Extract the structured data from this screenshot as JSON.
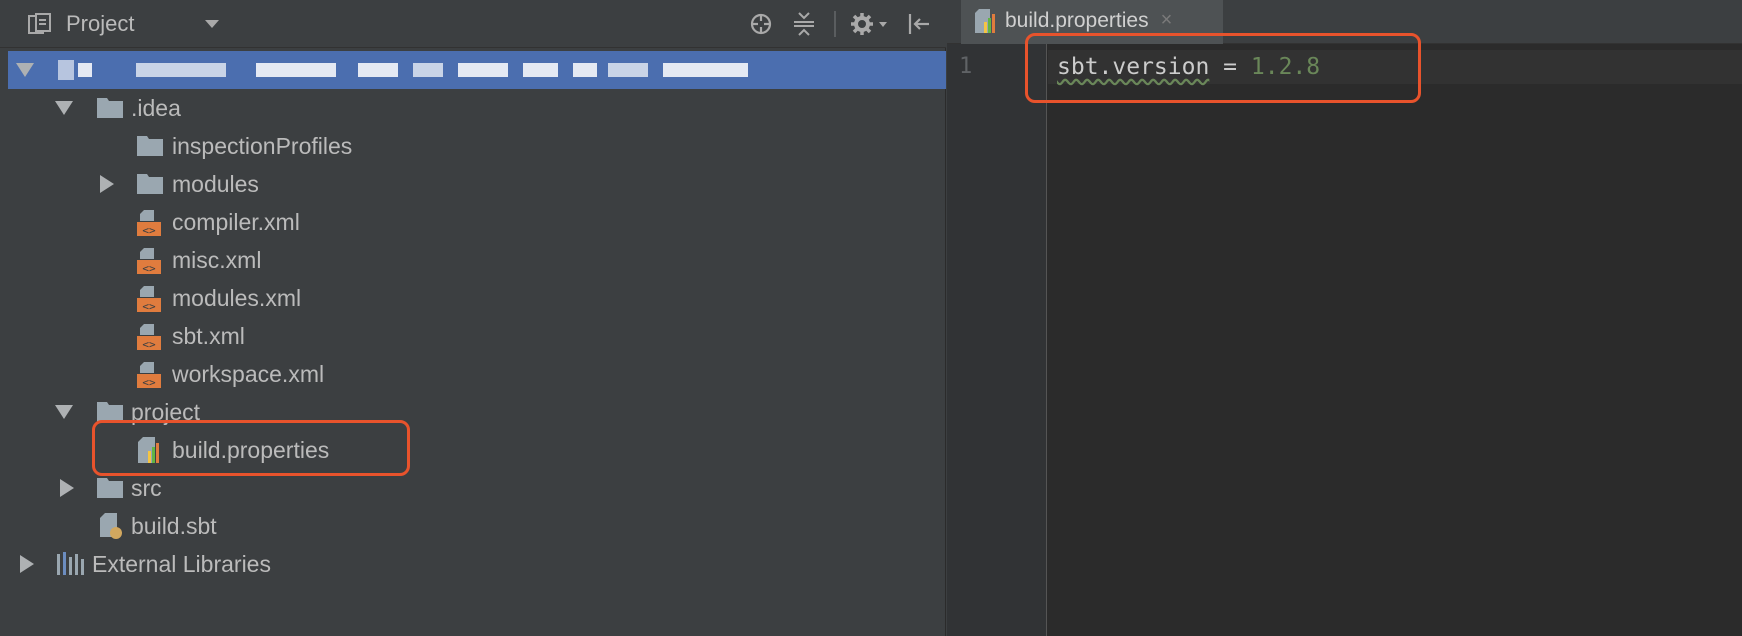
{
  "panel": {
    "title": "Project",
    "toolbar_icons": [
      "locate-icon",
      "collapse-all-icon",
      "gear-icon",
      "hide-panel-icon"
    ]
  },
  "tree": {
    "root_label": "",
    "idea": ".idea",
    "inspection_profiles": "inspectionProfiles",
    "modules": "modules",
    "compiler_xml": "compiler.xml",
    "misc_xml": "misc.xml",
    "modules_xml": "modules.xml",
    "sbt_xml": "sbt.xml",
    "workspace_xml": "workspace.xml",
    "project": "project",
    "build_properties": "build.properties",
    "src": "src",
    "build_sbt": "build.sbt",
    "external_libraries": "External Libraries"
  },
  "editor": {
    "tab_label": "build.properties",
    "tab_close": "×",
    "line_number": "1",
    "code_key": "sbt.version",
    "code_op": " = ",
    "code_value": "1.2.8"
  },
  "colors": {
    "selection": "#4b6eaf",
    "callout": "#e8532c",
    "value_green": "#6a8759"
  }
}
